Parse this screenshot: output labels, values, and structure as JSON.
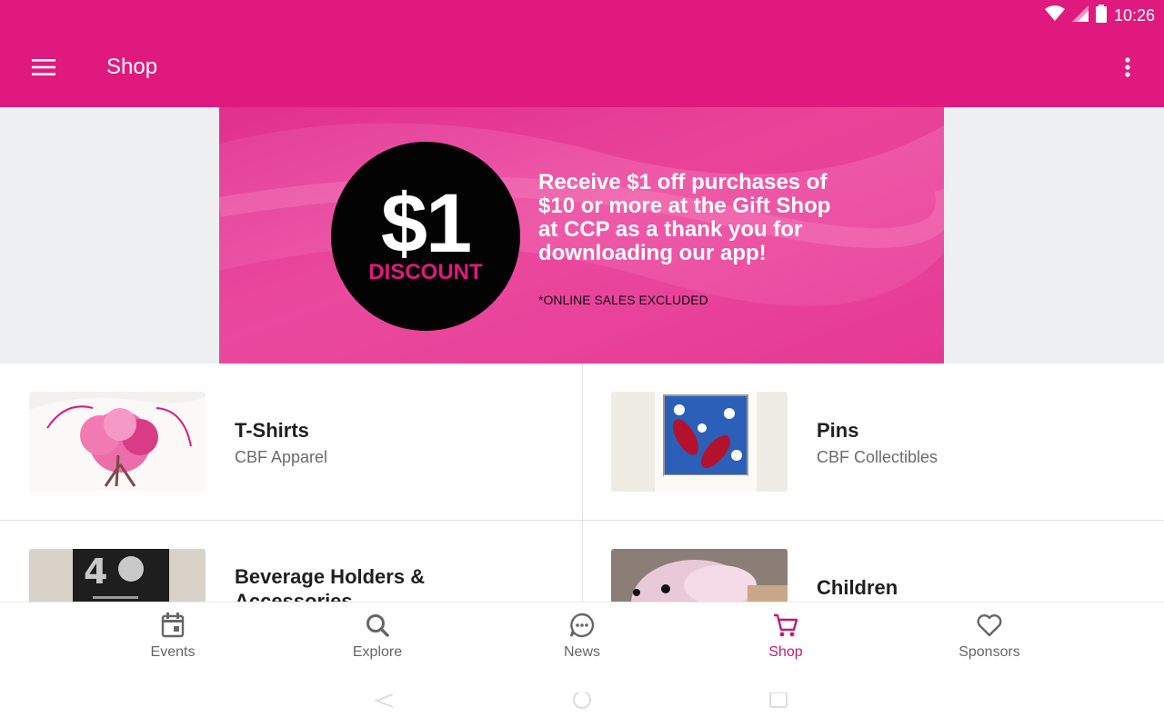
{
  "status_bar": {
    "time": "10:26"
  },
  "app_bar": {
    "title": "Shop"
  },
  "banner": {
    "amount": "$1",
    "badge_word": "DISCOUNT",
    "message_lines": [
      "Receive $1 off purchases of",
      "$10 or more at the Gift Shop",
      "at CCP as a thank you for",
      "downloading our app!"
    ],
    "note": "*ONLINE SALES EXCLUDED"
  },
  "categories": [
    {
      "title": "T-Shirts",
      "subtitle": "CBF Apparel"
    },
    {
      "title": "Pins",
      "subtitle": "CBF Collectibles"
    },
    {
      "title_lines": [
        "Beverage Holders &",
        "Accessories"
      ]
    },
    {
      "title": "Children"
    }
  ],
  "bottom_nav": {
    "items": [
      {
        "label": "Events",
        "icon": "calendar-icon"
      },
      {
        "label": "Explore",
        "icon": "search-icon"
      },
      {
        "label": "News",
        "icon": "chat-bubble-icon"
      },
      {
        "label": "Shop",
        "icon": "cart-icon",
        "active": true
      },
      {
        "label": "Sponsors",
        "icon": "heart-icon"
      }
    ]
  },
  "colors": {
    "primary": "#e0197f",
    "active_nav": "#c2187a",
    "banner_circle": "#030303"
  }
}
